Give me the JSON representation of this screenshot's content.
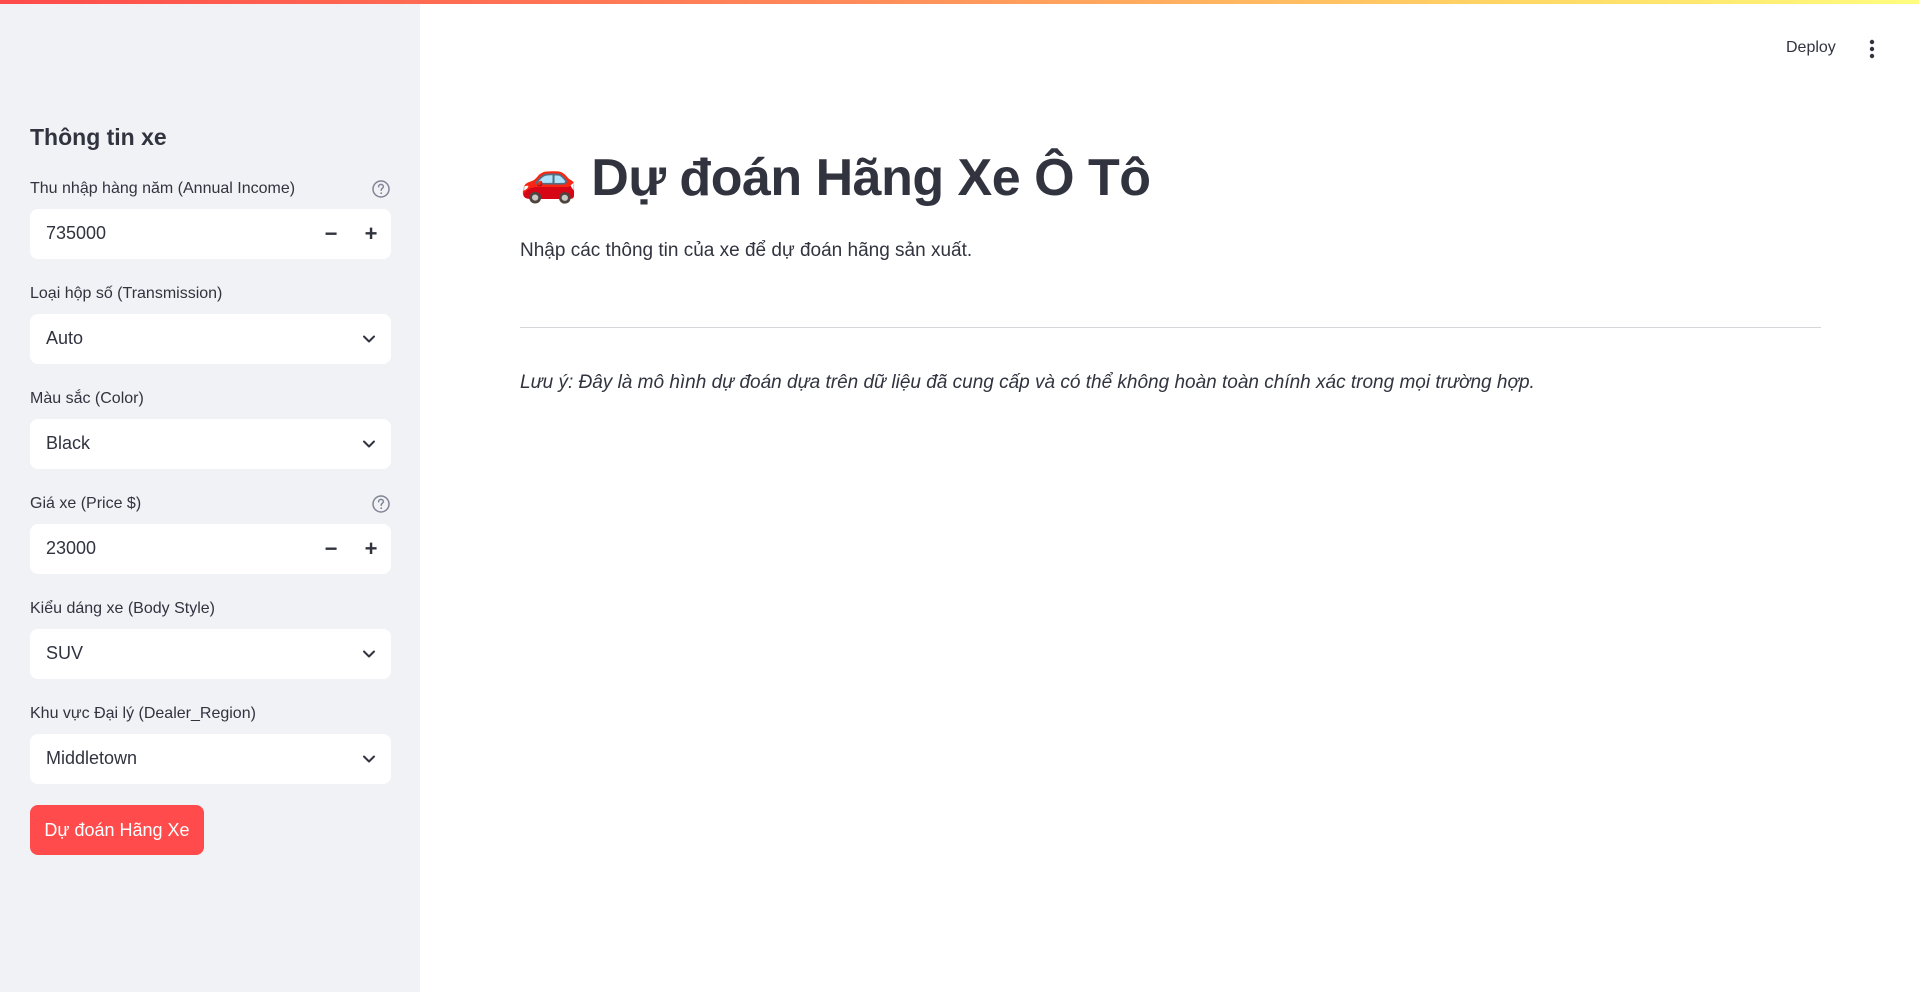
{
  "header": {
    "deploy_label": "Deploy",
    "menu_icon": "vertical-dots-icon"
  },
  "sidebar": {
    "title": "Thông tin xe",
    "fields": [
      {
        "label": "Thu nhập hàng năm (Annual Income)",
        "type": "number",
        "value": "735000",
        "has_help": true
      },
      {
        "label": "Loại hộp số (Transmission)",
        "type": "select",
        "value": "Auto"
      },
      {
        "label": "Màu sắc (Color)",
        "type": "select",
        "value": "Black"
      },
      {
        "label": "Giá xe (Price $)",
        "type": "number",
        "value": "23000",
        "has_help": true
      },
      {
        "label": "Kiểu dáng xe (Body Style)",
        "type": "select",
        "value": "SUV"
      },
      {
        "label": "Khu vực Đại lý (Dealer_Region)",
        "type": "select",
        "value": "Middletown"
      }
    ],
    "stepper_minus": "−",
    "stepper_plus": "+",
    "submit_label": "Dự đoán Hãng Xe"
  },
  "main": {
    "title_emoji": "🚗",
    "title": "Dự đoán Hãng Xe Ô Tô",
    "subtitle": "Nhập các thông tin của xe để dự đoán hãng sản xuất.",
    "note": "Lưu ý: Đây là mô hình dự đoán dựa trên dữ liệu đã cung cấp và có thể không hoàn toàn chính xác trong mọi trường hợp."
  },
  "colors": {
    "primary": "#ff4b4b",
    "sidebar_bg": "#f0f2f6",
    "text": "#31333f"
  }
}
